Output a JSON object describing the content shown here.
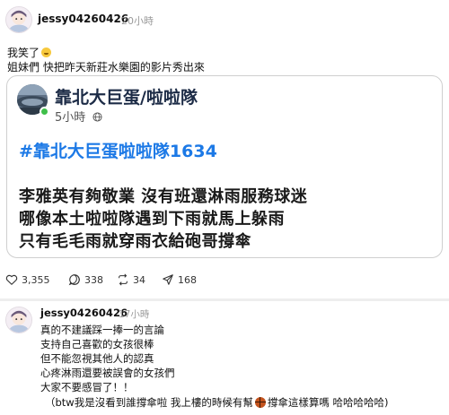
{
  "post": {
    "username": "jessy04260426",
    "timestamp": "20小時",
    "lines": [
      "我笑了",
      "姐妹們 快把昨天新莊水樂園的影片秀出來"
    ],
    "emoji_icon": "grinning-sweat-emoji-icon"
  },
  "quoted_post": {
    "author": "靠北大巨蛋/啦啦隊",
    "time": "5小時",
    "visibility_icon": "globe-icon",
    "hashtag": "#靠北大巨蛋啦啦隊1634",
    "body_lines": [
      "李雅英有夠敬業 沒有班還淋雨服務球迷",
      "哪像本土啦啦隊遇到下雨就馬上躲雨",
      "只有毛毛雨就穿雨衣給砲哥撐傘"
    ]
  },
  "actions": {
    "like_count": "3,355",
    "comment_count": "338",
    "repost_count": "34",
    "share_count": "168"
  },
  "reply": {
    "username": "jessy04260426",
    "timestamp": "17小時",
    "lines": [
      "真的不建議踩一捧一的言論",
      "支持自己喜歡的女孩很棒",
      "但不能忽視其他人的認真",
      "心疼淋雨還要被誤會的女孩們",
      "大家不要感冒了！！"
    ],
    "last_line_before": "（btw我是沒看到誰撐傘啦 我上樓的時候有幫",
    "last_line_after": "撐傘這樣算嗎 哈哈哈哈哈)",
    "inline_icon": "basketball-icon"
  },
  "colors": {
    "hashtag": "#1c79e6",
    "online": "#3fbf4a",
    "divider": "#eeeeee"
  }
}
